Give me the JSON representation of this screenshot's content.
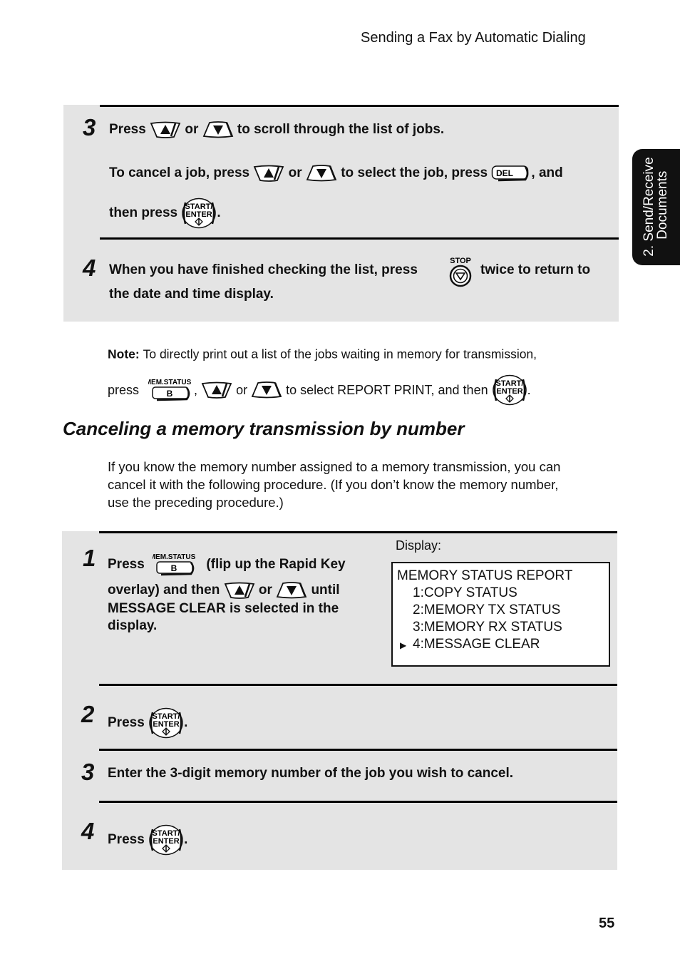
{
  "header": {
    "running_title": "Sending a Fax by Automatic Dialing"
  },
  "side_tab": {
    "line1": "2. Send/Receive",
    "line2": "Documents"
  },
  "page_number": "55",
  "icons": {
    "up_arrow_key": "up-arrow-key",
    "down_arrow_key": "down-arrow-key",
    "del_key_label": "DEL",
    "start_enter_top": "START/",
    "start_enter_bottom": "ENTER",
    "stop_label": "STOP",
    "mem_status_label": "MEM.STATUS",
    "mem_status_key": "B"
  },
  "top_steps": {
    "step3": {
      "number": "3",
      "line1": {
        "press": "Press",
        "or": "or",
        "rest": "to scroll through the list of jobs."
      },
      "line2": {
        "lead": "To cancel a job, press",
        "or": "or",
        "mid": "to select the job, press",
        "tail": ", and"
      },
      "line3": {
        "lead": "then press",
        "tail": "."
      }
    },
    "step4": {
      "number": "4",
      "line1": {
        "lead": "When you have finished checking the list, press",
        "tail": "twice to return to"
      },
      "line2": "the date and time display."
    }
  },
  "note": {
    "label": "Note:",
    "line1": "To directly print out a list of the jobs waiting in memory for transmission,",
    "line2": {
      "press": "press",
      "comma": ",",
      "or": "or",
      "mid": "to select REPORT PRINT, and then",
      "tail": "."
    }
  },
  "section": {
    "heading": "Canceling a memory transmission by number",
    "intro": [
      "If you know the memory number assigned to a memory transmission, you can",
      "cancel it with the following procedure. (If you don’t know the memory number,",
      "use the preceding procedure.)"
    ]
  },
  "bottom_steps": {
    "step1": {
      "number": "1",
      "line1": {
        "press": "Press",
        "tail": "(flip up the Rapid Key"
      },
      "line2": {
        "lead": "overlay) and then",
        "or": "or",
        "tail": "until"
      },
      "line3": "MESSAGE CLEAR is selected in the",
      "line4": "display."
    },
    "display": {
      "label": "Display:",
      "title": "MEMORY STATUS REPORT",
      "items": [
        "1:COPY STATUS",
        "2:MEMORY TX STATUS",
        "3:MEMORY RX STATUS",
        "4:MESSAGE CLEAR"
      ],
      "selected_index": 3,
      "cursor": "▶"
    },
    "step2": {
      "number": "2",
      "press": "Press",
      "tail": "."
    },
    "step3": {
      "number": "3",
      "text": "Enter the 3-digit memory number of the job you wish to cancel."
    },
    "step4": {
      "number": "4",
      "press": "Press",
      "tail": "."
    }
  },
  "colors": {
    "panel": "#e4e4e4",
    "rule": "#000000",
    "tab": "#111111"
  }
}
